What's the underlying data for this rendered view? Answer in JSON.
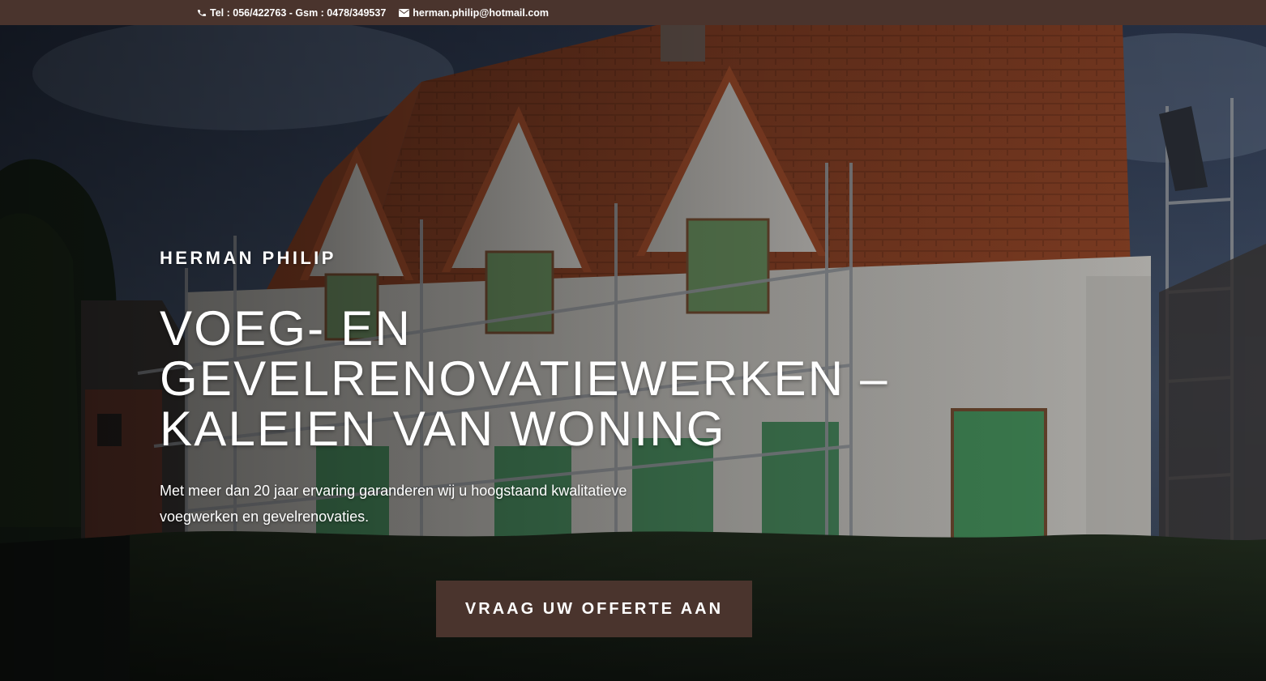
{
  "topbar": {
    "phone_icon": "phone-icon",
    "phone_text": "Tel : 056/422763 - Gsm : 0478/349537",
    "email_icon": "envelope-icon",
    "email_text": "herman.philip@hotmail.com",
    "background_color": "#4a342d"
  },
  "hero": {
    "eyebrow": "HERMAN PHILIP",
    "headline": "VOEG- EN GEVELRENOVATIEWERKEN – KALEIEN VAN WONING",
    "lead": "Met meer dan 20 jaar ervaring garanderen wij u hoogstaand kwalitatieve voegwerken en gevelrenovaties.",
    "cta_label": "VRAAG UW OFFERTE AAN",
    "cta_color": "#4a342d"
  }
}
